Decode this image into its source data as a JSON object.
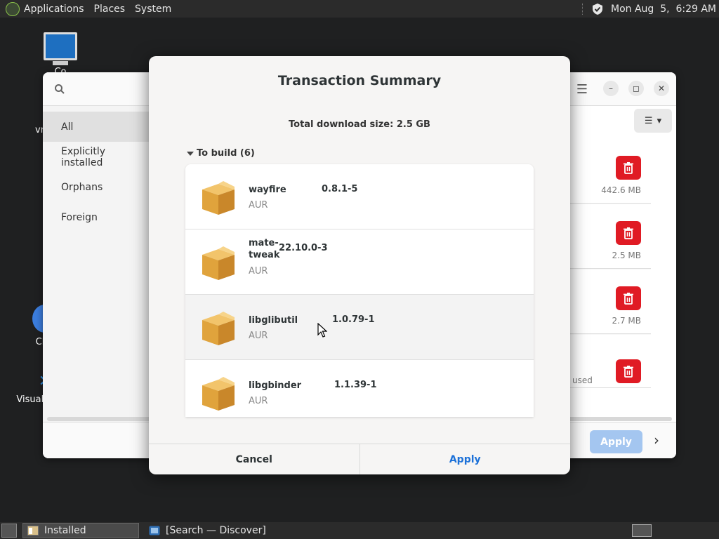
{
  "top_panel": {
    "menus": [
      "Applications",
      "Places",
      "System"
    ],
    "clock": "Mon Aug  5,  6:29 AM"
  },
  "desktop": {
    "icons": [
      {
        "label": "Co"
      },
      {
        "label": "vm"
      },
      {
        "label": "Chr"
      },
      {
        "label": "Visual S"
      }
    ]
  },
  "discover": {
    "sidebar": {
      "items": [
        {
          "label": "All"
        },
        {
          "label": "Explicitly installed"
        },
        {
          "label": "Orphans"
        },
        {
          "label": "Foreign"
        }
      ]
    },
    "sizes": [
      "442.6 MB",
      "2.5 MB",
      "2.7 MB",
      "used"
    ],
    "apply_label": "Apply",
    "colors": {
      "danger": "#e01b24",
      "accent": "#1c71d8"
    }
  },
  "dialog": {
    "title": "Transaction Summary",
    "download_size": "Total download size: 2.5 GB",
    "section_label": "To build (6)",
    "packages": [
      {
        "name": "wayfire",
        "version": "0.8.1-5",
        "repo": "AUR"
      },
      {
        "name": "mate-tweak",
        "name_line1": "mate-",
        "name_line2": "tweak",
        "version": "22.10.0-3",
        "repo": "AUR"
      },
      {
        "name": "libglibutil",
        "version": "1.0.79-1",
        "repo": "AUR"
      },
      {
        "name": "libgbinder",
        "version": "1.1.39-1",
        "repo": "AUR"
      }
    ],
    "cancel_label": "Cancel",
    "apply_label": "Apply"
  },
  "taskbar": {
    "items": [
      {
        "label": "Installed"
      },
      {
        "label": "[Search — Discover]"
      }
    ]
  }
}
